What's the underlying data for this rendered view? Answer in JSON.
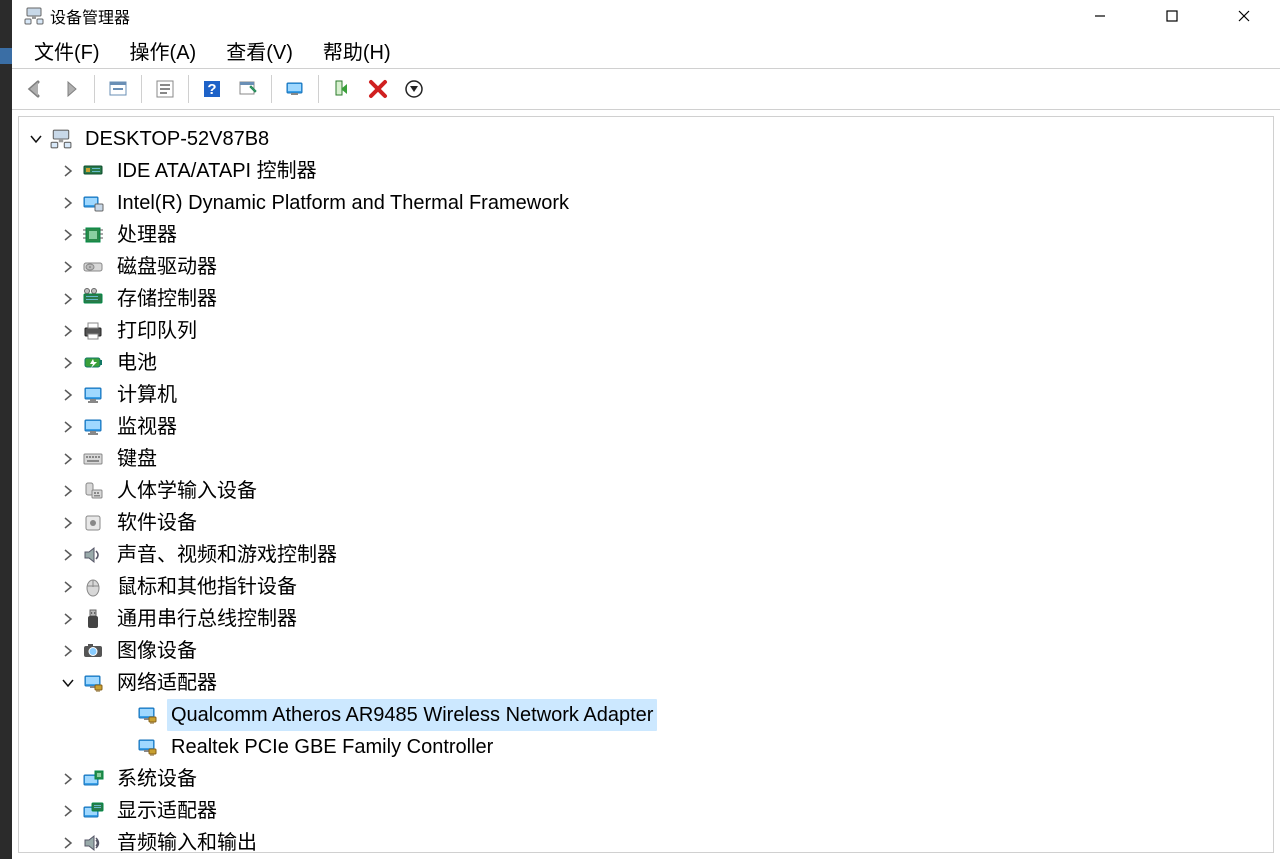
{
  "window": {
    "title": "设备管理器"
  },
  "menu": {
    "file": "文件(F)",
    "action": "操作(A)",
    "view": "查看(V)",
    "help": "帮助(H)"
  },
  "toolbar": {
    "back_icon": "back-icon",
    "forward_icon": "forward-icon",
    "show_hidden_icon": "show-hidden-icon",
    "details_icon": "details-icon",
    "help_icon": "help-icon",
    "scan_icon": "scan-hardware-icon",
    "monitor_icon": "monitor-icon",
    "enable_icon": "enable-device-icon",
    "disable_icon": "disable-device-icon",
    "more_icon": "more-icon"
  },
  "tree": {
    "root": "DESKTOP-52V87B8",
    "categories": [
      {
        "label": "IDE ATA/ATAPI 控制器",
        "icon": "ide-controller-icon"
      },
      {
        "label": "Intel(R) Dynamic Platform and Thermal Framework",
        "icon": "chip-pc-icon"
      },
      {
        "label": "处理器",
        "icon": "cpu-icon"
      },
      {
        "label": "磁盘驱动器",
        "icon": "disk-drive-icon"
      },
      {
        "label": "存储控制器",
        "icon": "storage-controller-icon"
      },
      {
        "label": "打印队列",
        "icon": "printer-icon"
      },
      {
        "label": "电池",
        "icon": "battery-icon"
      },
      {
        "label": "计算机",
        "icon": "computer-monitor-icon"
      },
      {
        "label": "监视器",
        "icon": "monitor-icon"
      },
      {
        "label": "键盘",
        "icon": "keyboard-icon"
      },
      {
        "label": "人体学输入设备",
        "icon": "hid-icon"
      },
      {
        "label": "软件设备",
        "icon": "software-device-icon"
      },
      {
        "label": "声音、视频和游戏控制器",
        "icon": "sound-icon"
      },
      {
        "label": "鼠标和其他指针设备",
        "icon": "mouse-icon"
      },
      {
        "label": "通用串行总线控制器",
        "icon": "usb-icon"
      },
      {
        "label": "图像设备",
        "icon": "imaging-device-icon"
      },
      {
        "label": "网络适配器",
        "icon": "network-adapter-icon",
        "expanded": true,
        "children": [
          {
            "label": "Qualcomm Atheros AR9485 Wireless Network Adapter",
            "icon": "network-adapter-icon",
            "selected": true
          },
          {
            "label": "Realtek PCIe GBE Family Controller",
            "icon": "network-adapter-icon"
          }
        ]
      },
      {
        "label": "系统设备",
        "icon": "system-device-icon"
      },
      {
        "label": "显示适配器",
        "icon": "display-adapter-icon"
      },
      {
        "label": "音频输入和输出",
        "icon": "audio-io-icon"
      }
    ]
  }
}
